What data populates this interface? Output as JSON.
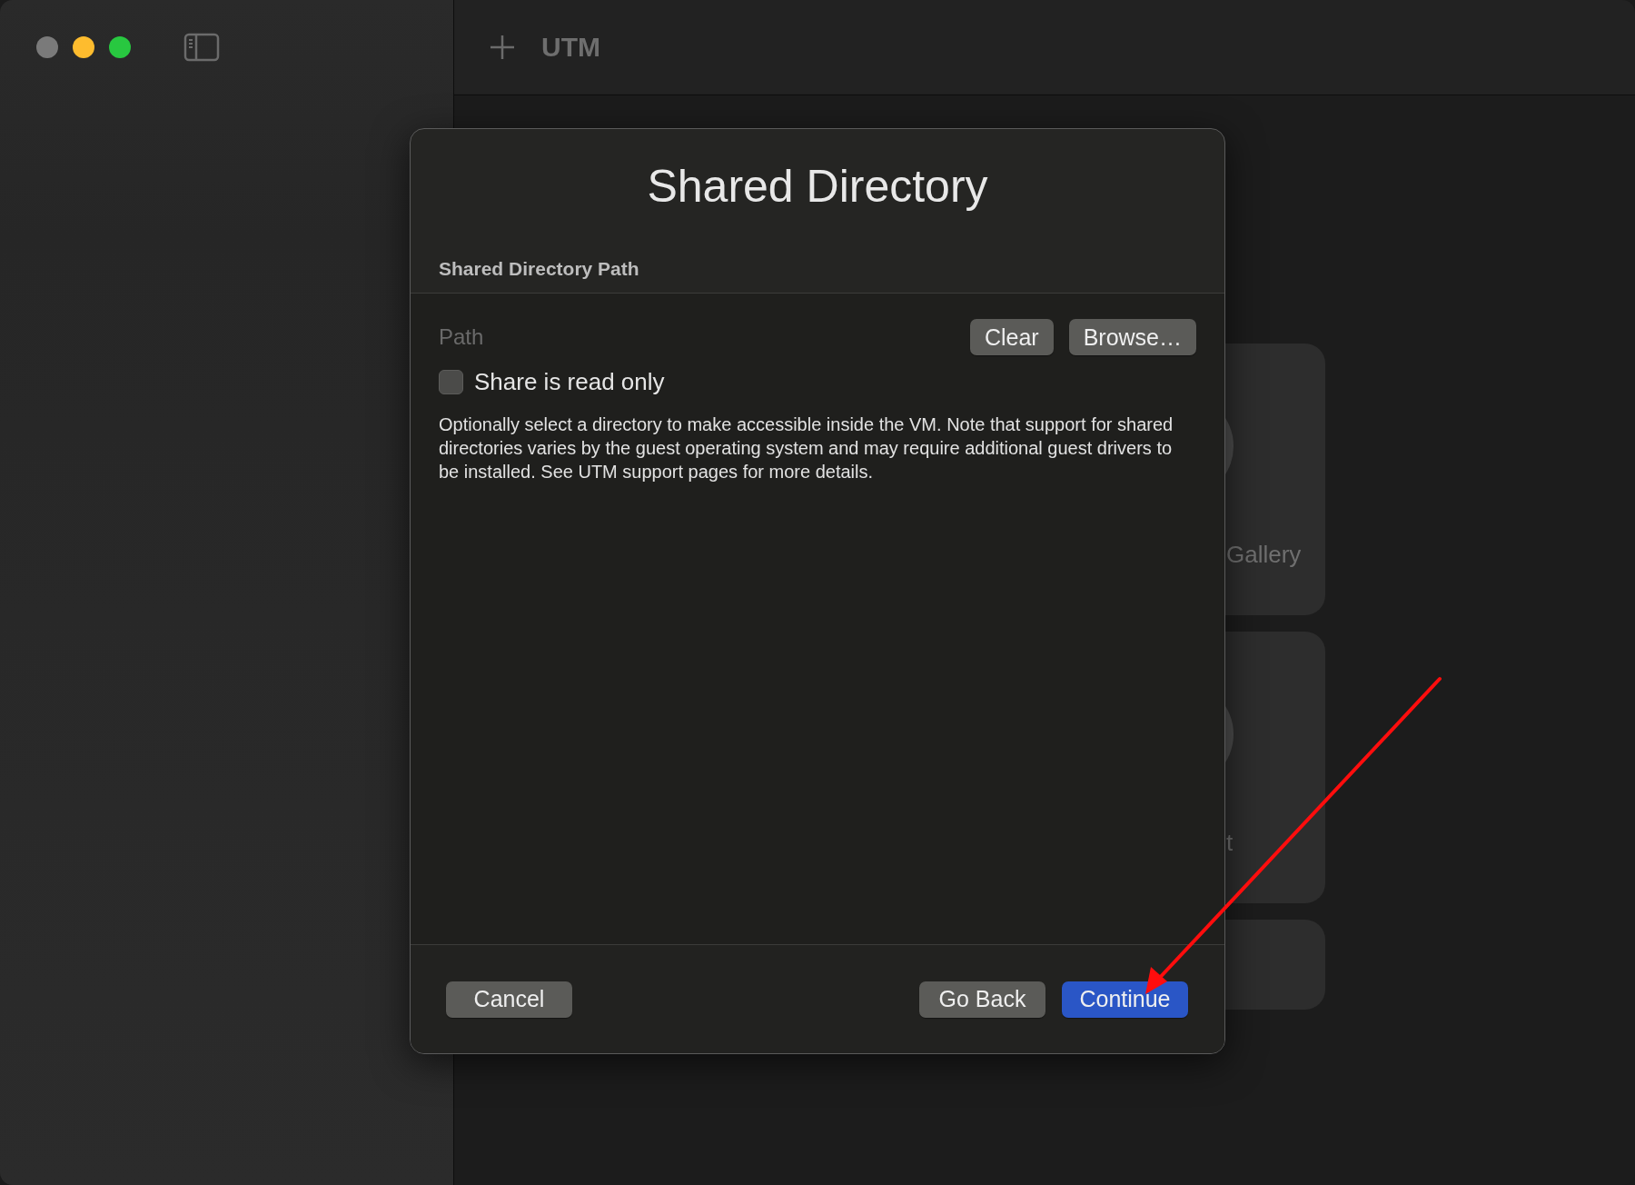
{
  "window_controls": [
    {
      "color": "#7a7a7a"
    },
    {
      "color": "#febc2e"
    },
    {
      "color": "#28c840"
    }
  ],
  "toolbar": {
    "title": "UTM"
  },
  "background_cards": [
    {
      "kind": "labeled",
      "label": "Gallery"
    },
    {
      "kind": "labeled",
      "label": "t"
    },
    {
      "kind": "blank"
    }
  ],
  "dialog": {
    "title": "Shared Directory",
    "section_header": "Shared Directory Path",
    "path_field": {
      "placeholder": "Path"
    },
    "path_buttons": [
      "Clear",
      "Browse…"
    ],
    "read_only_checkbox": {
      "label": "Share is read only",
      "checked": false
    },
    "description": "Optionally select a directory to make accessible inside the VM. Note that support for shared directories varies by the guest operating system and may require additional guest drivers to be installed. See UTM support pages for more details.",
    "footer_buttons": [
      {
        "label": "Cancel",
        "kind": "secondary"
      },
      {
        "label": "Go Back",
        "kind": "secondary"
      },
      {
        "label": "Continue",
        "kind": "primary"
      }
    ]
  }
}
